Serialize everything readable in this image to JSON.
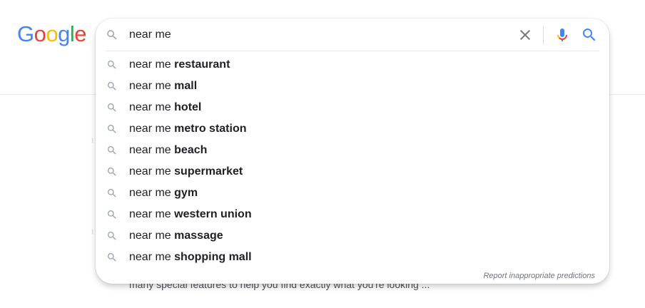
{
  "logo": {
    "text": "Google",
    "letters": [
      "G",
      "o",
      "o",
      "g",
      "l",
      "e"
    ],
    "colors": [
      "#4285F4",
      "#EA4335",
      "#FBBC05",
      "#4285F4",
      "#34A853",
      "#EA4335"
    ]
  },
  "search": {
    "query": "near me"
  },
  "icons": {
    "search": "search-icon",
    "clear": "close-icon",
    "mic": "mic-icon",
    "submit": "search-icon"
  },
  "suggestions": [
    {
      "prefix": "near me ",
      "completion": "restaurant"
    },
    {
      "prefix": "near me ",
      "completion": "mall"
    },
    {
      "prefix": "near me ",
      "completion": "hotel"
    },
    {
      "prefix": "near me ",
      "completion": "metro station"
    },
    {
      "prefix": "near me ",
      "completion": "beach"
    },
    {
      "prefix": "near me ",
      "completion": "supermarket"
    },
    {
      "prefix": "near me ",
      "completion": "gym"
    },
    {
      "prefix": "near me ",
      "completion": "western union"
    },
    {
      "prefix": "near me ",
      "completion": "massage"
    },
    {
      "prefix": "near me ",
      "completion": "shopping mall"
    }
  ],
  "report_link": "Report inappropriate predictions",
  "background_snippet": "many special features to help you find exactly what you're looking ..."
}
